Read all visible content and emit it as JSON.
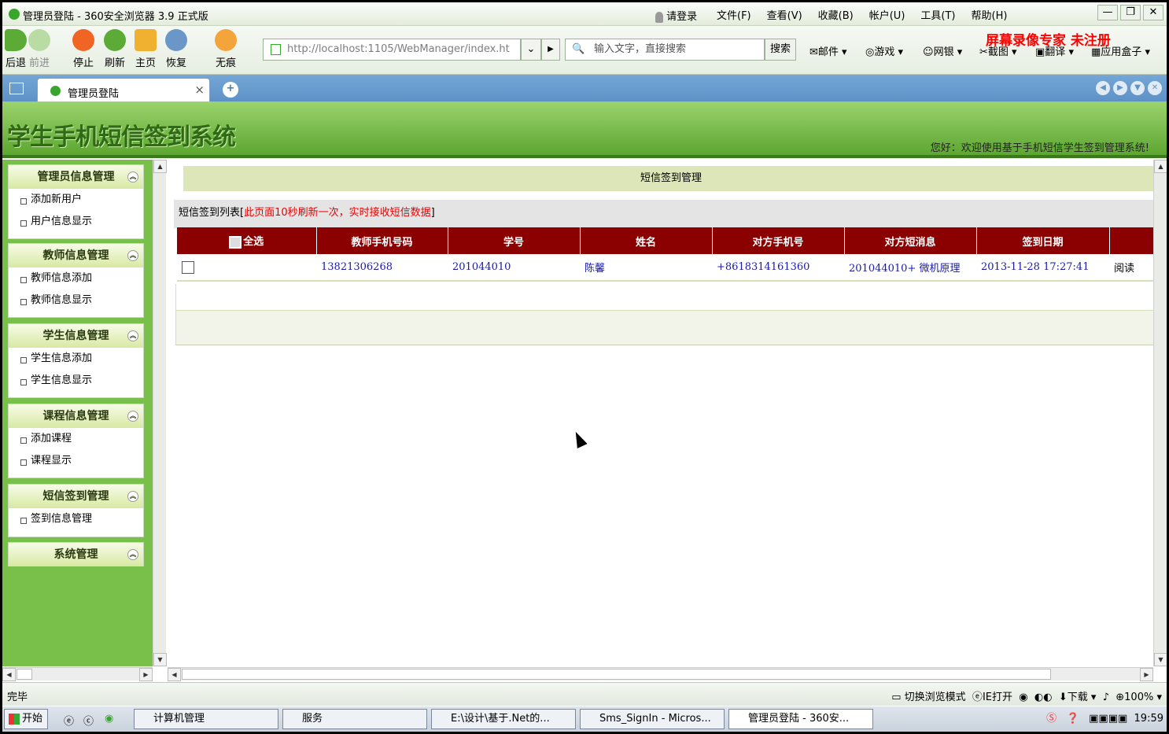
{
  "window": {
    "title": "管理员登陆 - 360安全浏览器 3.9 正式版",
    "login": "请登录"
  },
  "menu": [
    "文件(F)",
    "查看(V)",
    "收藏(B)",
    "帐户(U)",
    "工具(T)",
    "帮助(H)"
  ],
  "watermark": "屏幕录像专家  未注册",
  "toolbar": {
    "back": "后退",
    "forward": "前进",
    "stop": "停止",
    "refresh": "刷新",
    "home": "主页",
    "restore": "恢复",
    "incognito": "无痕",
    "address": "http://localhost:1105/WebManager/index.ht",
    "search_placeholder": "输入文字，直接搜索",
    "search_btn": "搜索",
    "ext": [
      "邮件",
      "游戏",
      "网银",
      "截图",
      "翻译",
      "应用盒子"
    ]
  },
  "tab": {
    "label": "管理员登陆"
  },
  "header": {
    "system_name": "学生手机短信签到系统",
    "welcome": "您好：欢迎使用基于手机短信学生签到管理系统!"
  },
  "sidebar": [
    {
      "title": "管理员信息管理",
      "items": [
        "添加新用户",
        "用户信息显示"
      ]
    },
    {
      "title": "教师信息管理",
      "items": [
        "教师信息添加",
        "教师信息显示"
      ]
    },
    {
      "title": "学生信息管理",
      "items": [
        "学生信息添加",
        "学生信息显示"
      ]
    },
    {
      "title": "课程信息管理",
      "items": [
        "添加课程",
        "课程显示"
      ]
    },
    {
      "title": "短信签到管理",
      "items": [
        "签到信息管理"
      ]
    },
    {
      "title": "系统管理",
      "items": []
    }
  ],
  "main": {
    "banner": "短信签到管理",
    "list_title": "短信签到列表[",
    "list_note": "此页面10秒刷新一次，实时接收短信数据",
    "list_end": "]",
    "select_all": "全选",
    "columns": [
      "教师手机号码",
      "学号",
      "姓名",
      "对方手机号",
      "对方短消息",
      "签到日期"
    ],
    "rows": [
      {
        "teacher_phone": "13821306268",
        "student_id": "201044010",
        "name": "陈馨",
        "from_phone": "+8618314161360",
        "message": "201044010+ 微机原理",
        "date": "2013-11-28 17:27:41",
        "action": "阅读"
      }
    ]
  },
  "status": {
    "text": "完毕",
    "mode": "切换浏览模式",
    "ie": "IE打开",
    "download": "下载",
    "zoom": "100%"
  },
  "taskbar": {
    "start": "开始",
    "tasks": [
      "计算机管理",
      "服务",
      "E:\\设计\\基于.Net的...",
      "Sms_SignIn - Micros...",
      "管理员登陆 - 360安..."
    ],
    "time": "19:59"
  }
}
